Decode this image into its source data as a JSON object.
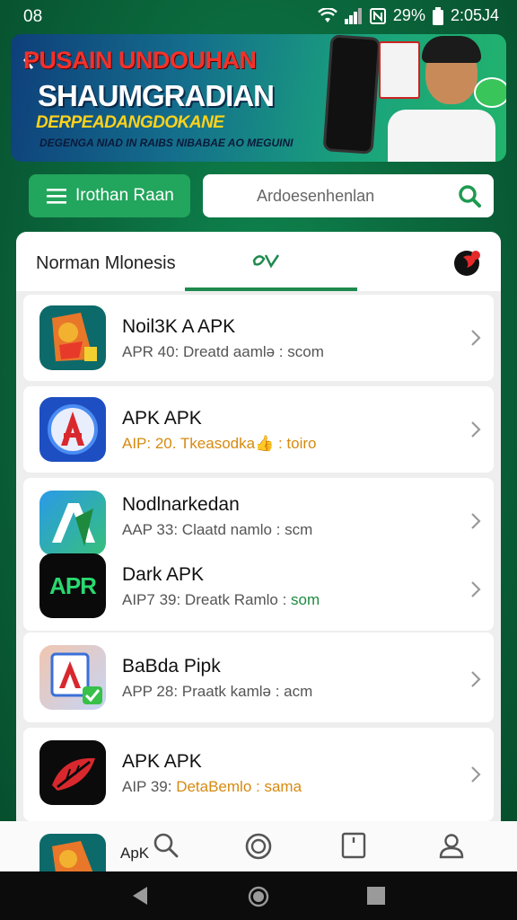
{
  "status_bar": {
    "time": "08",
    "battery": "29%",
    "clock": "2:05J4"
  },
  "banner": {
    "line1": "PUSAIN UNDOUHAN",
    "line2": "SHAUMGRADIAN",
    "line3": "DERPEADANGDOKANE",
    "line4": "DEGENGA NIAD IN RAIBS NIBABAE AO MEGUINI"
  },
  "controls": {
    "menu_label": "Irothan Raan",
    "search_placeholder": "Ardoesenhenlan"
  },
  "panel": {
    "title": "Norman Mlonesis",
    "tab_label": "Q1"
  },
  "apps": [
    {
      "name": "Noil3K A APK",
      "meta": "APR 40: Dreatd aamlə : scom",
      "meta_tail": ""
    },
    {
      "name": "APK APK",
      "meta": "AIP: 20. Tkeasodka",
      "meta_tail": "👍 : toiro"
    },
    {
      "name": "Nodlnarkedan",
      "meta": "AAP 33: Claatd namlo : scm",
      "meta_tail": ""
    },
    {
      "name": "Dark APK",
      "meta": "AIP7 39: Dreatk Ramlo : ",
      "meta_tail": "som",
      "icon_text": "APR"
    },
    {
      "name": "BaBda Pipk",
      "meta": "APP 28: Praatk kamlə : acm",
      "meta_tail": ""
    },
    {
      "name": "APK APK",
      "meta": "AIP 39: ",
      "meta_tail": "DetaBemlo : sama"
    }
  ],
  "bottom_nav": {
    "label": "ApK"
  },
  "colors": {
    "accent_green": "#22a55c",
    "tab_underline": "#1e8a4e",
    "background": "#0b6a3e"
  }
}
